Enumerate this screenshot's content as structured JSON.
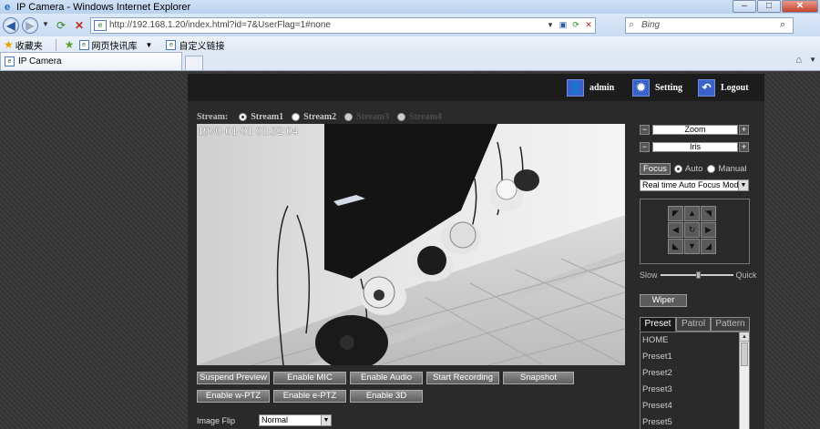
{
  "window": {
    "title": "IP Camera - Windows Internet Explorer",
    "minimize": "–",
    "maximize": "□",
    "close": "✕"
  },
  "browser": {
    "url": "http://192.168.1.20/index.html?id=7&UserFlag=1#none",
    "search_placeholder": "Bing",
    "favorites_label": "收藏夹",
    "favorites_items": [
      "网页快讯库",
      "自定义链接"
    ],
    "tab_title": "IP Camera"
  },
  "header": {
    "user": "admin",
    "setting": "Setting",
    "logout": "Logout"
  },
  "stream": {
    "label": "Stream:",
    "options": [
      {
        "label": "Stream1",
        "selected": true,
        "enabled": true
      },
      {
        "label": "Stream2",
        "selected": false,
        "enabled": true
      },
      {
        "label": "Stream3",
        "selected": false,
        "enabled": false
      },
      {
        "label": "Stream4",
        "selected": false,
        "enabled": false
      }
    ]
  },
  "video": {
    "timestamp": "1970-01-01 01:32:04"
  },
  "buttons_row1": [
    "Suspend Preview",
    "Enable MIC",
    "Enable Audio",
    "Start Recording",
    "Snapshot"
  ],
  "buttons_row2": [
    "Enable w-PTZ",
    "Enable e-PTZ",
    "Enable 3D"
  ],
  "image_flip": {
    "label": "Image Flip",
    "value": "Normal"
  },
  "ptz": {
    "zoom": "Zoom",
    "iris": "Iris",
    "minus": "−",
    "plus": "+",
    "focus_button": "Focus",
    "focus_auto": "Auto",
    "focus_manual": "Manual",
    "focus_mode_selected": "auto",
    "af_mode": "Real time Auto Focus Mode",
    "slow": "Slow",
    "quick": "Quick",
    "speed_level": 0.52,
    "wiper": "Wiper",
    "arrows": {
      "up_left": "◤",
      "up": "▲",
      "up_right": "◥",
      "left": "◀",
      "center": "↻",
      "right": "▶",
      "down_left": "◣",
      "down": "▼",
      "down_right": "◢"
    }
  },
  "tabs": [
    "Preset",
    "Patrol",
    "Pattern"
  ],
  "active_tab": "Preset",
  "presets": [
    "HOME",
    "Preset1",
    "Preset2",
    "Preset3",
    "Preset4",
    "Preset5"
  ],
  "colors": {
    "accent_icon": "#3a62c8",
    "panel_bg": "#2a2a2a"
  }
}
